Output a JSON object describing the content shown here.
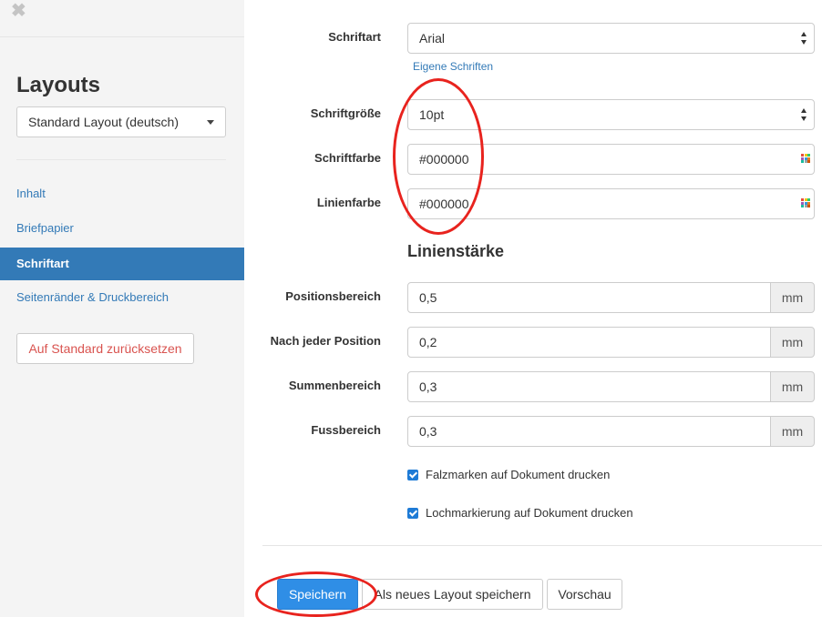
{
  "sidebar": {
    "close_glyph": "✖",
    "title": "Layouts",
    "layout_select": "Standard Layout (deutsch)",
    "nav": [
      "Inhalt",
      "Briefpapier",
      "Schriftart",
      "Seitenränder & Druckbereich"
    ],
    "active_nav": "Schriftart",
    "reset_button": "Auf Standard zurücksetzen"
  },
  "form": {
    "font": {
      "label": "Schriftart",
      "value": "Arial",
      "link": "Eigene Schriften"
    },
    "font_size": {
      "label": "Schriftgröße",
      "value": "10pt"
    },
    "font_color": {
      "label": "Schriftfarbe",
      "value": "#000000"
    },
    "line_color": {
      "label": "Linienfarbe",
      "value": "#000000"
    },
    "line_width_title": "Linienstärke",
    "unit": "mm",
    "line_widths": [
      {
        "label": "Positionsbereich",
        "value": "0,5"
      },
      {
        "label": "Nach jeder Position",
        "value": "0,2"
      },
      {
        "label": "Summenbereich",
        "value": "0,3"
      },
      {
        "label": "Fussbereich",
        "value": "0,3"
      }
    ],
    "checkboxes": [
      {
        "label": "Falzmarken auf Dokument drucken",
        "checked": true
      },
      {
        "label": "Lochmarkierung auf Dokument drucken",
        "checked": true
      }
    ]
  },
  "actions": {
    "save": "Speichern",
    "save_as_new": "Als neues Layout speichern",
    "preview": "Vorschau"
  },
  "colors": {
    "primary": "#2f8ee6",
    "active_nav_bg": "#337ab7",
    "link": "#337ab7",
    "danger": "#d9534f",
    "annotation": "#e8231e"
  }
}
